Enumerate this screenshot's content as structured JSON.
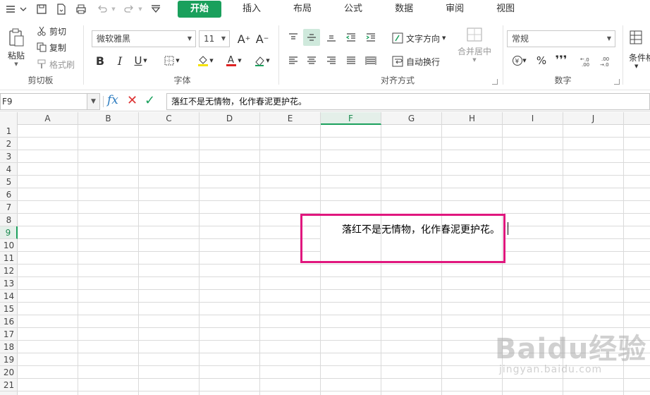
{
  "menu": {
    "tabs": [
      {
        "label": "开始",
        "active": true
      },
      {
        "label": "插入"
      },
      {
        "label": "布局"
      },
      {
        "label": "公式"
      },
      {
        "label": "数据"
      },
      {
        "label": "审阅"
      },
      {
        "label": "视图"
      }
    ]
  },
  "ribbon": {
    "clipboard": {
      "paste_label": "粘贴",
      "cut_label": "剪切",
      "copy_label": "复制",
      "format_painter_label": "格式刷",
      "group_label": "剪切板"
    },
    "font": {
      "font_name": "微软雅黑",
      "font_size": "11",
      "group_label": "字体"
    },
    "alignment": {
      "text_direction_label": "文字方向",
      "wrap_text_label": "自动换行",
      "merge_center_label": "合并居中",
      "group_label": "对齐方式"
    },
    "number": {
      "format": "常规",
      "group_label": "数字"
    },
    "conditional": {
      "label": "条件格"
    }
  },
  "formula_bar": {
    "name_box": "F9",
    "content": "落红不是无情物，化作春泥更护花。"
  },
  "grid": {
    "columns": [
      "A",
      "B",
      "C",
      "D",
      "E",
      "F",
      "G",
      "H",
      "I",
      "J"
    ],
    "rows": [
      "1",
      "2",
      "3",
      "4",
      "5",
      "6",
      "7",
      "8",
      "9",
      "10",
      "11",
      "12",
      "13",
      "14",
      "15",
      "16",
      "17",
      "18",
      "19",
      "20",
      "21"
    ],
    "active_column": "F",
    "active_row": "9",
    "editing_text": "落红不是无情物，化作春泥更护花。"
  },
  "watermark": {
    "logo": "Baidu经验",
    "url": "jingyan.baidu.com"
  },
  "colors": {
    "accent": "#1aa05c",
    "highlight_box": "#e0177e"
  }
}
